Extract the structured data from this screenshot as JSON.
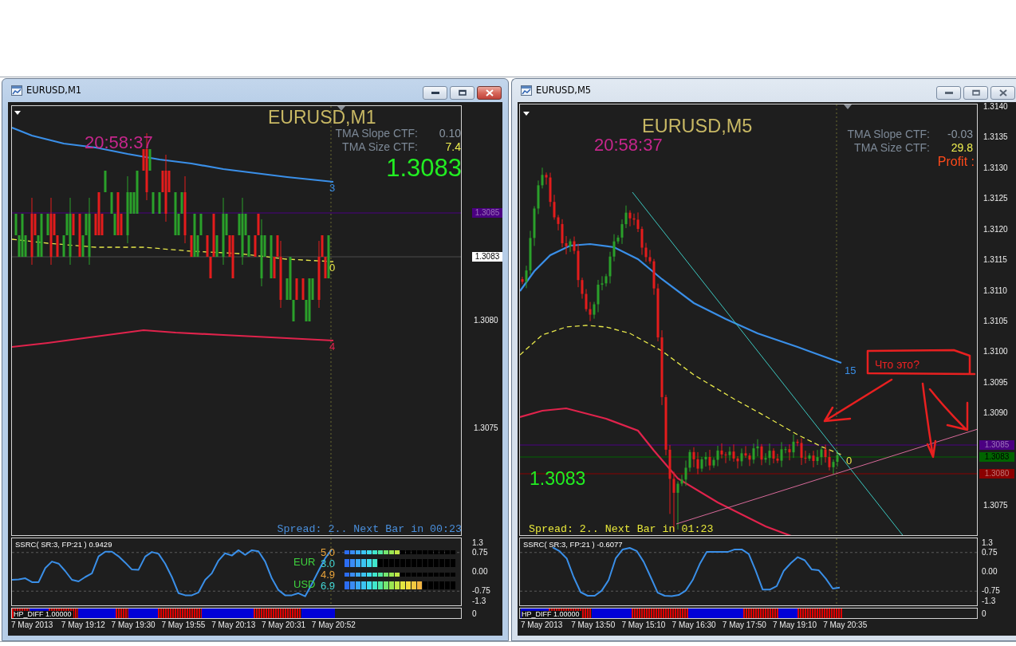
{
  "windows": [
    {
      "title": "EURUSD,M1",
      "active": true,
      "chart": {
        "symbol": "EURUSD,M1",
        "clock": "20:58:37",
        "indicators": [
          {
            "label": "TMA Slope CTF:",
            "value": "0.10",
            "color": "#8a96a3"
          },
          {
            "label": "TMA Size CTF:",
            "value": "7.4",
            "color": "#f0f050"
          }
        ],
        "price": "1.3083",
        "band_labels": [
          {
            "kind": "upper",
            "text": "3"
          },
          {
            "kind": "middle",
            "text": "0"
          },
          {
            "kind": "lower",
            "text": "4"
          }
        ],
        "spread": {
          "text": "Spread: 2.. Next Bar in 00:23",
          "color": "#4a8fdc"
        },
        "price_axis": [
          "1.3080",
          "1.3075"
        ],
        "price_tags": [
          {
            "text": "1.3085",
            "color": "#4b0082"
          },
          {
            "text": "1.3083",
            "color": "#ffffff"
          }
        ]
      },
      "oscillator": {
        "chart_data": {
          "type": "line",
          "title": "SSRC( SR:3, FP:21 ) 0.9429",
          "ylim": [
            -1.3,
            1.3
          ],
          "yticks": [
            {
              "value": 1.3,
              "label": "1.3"
            },
            {
              "value": 0.75,
              "label": "0.75"
            },
            {
              "value": 0,
              "label": "0.00"
            },
            {
              "value": -0.75,
              "label": "-0.75"
            },
            {
              "value": -1.3,
              "label": "-1.3"
            }
          ],
          "values": [
            -0.31,
            -0.29,
            -0.25,
            -0.4,
            -0.4,
            0.15,
            0.4,
            0.32,
            0.03,
            -0.31,
            -0.37,
            -0.2,
            -0.06,
            0.6,
            0.78,
            0.78,
            0.6,
            0.36,
            0.09,
            0.08,
            0.59,
            0.77,
            0.7,
            0.32,
            -0.2,
            -0.83,
            -0.91,
            -0.91,
            -0.8,
            -0.31,
            -0.06,
            0.44,
            0.72,
            0.63,
            0.84,
            0.66,
            0.84,
            0.8,
            0.4,
            -0.25,
            -0.71,
            -0.91,
            -0.91,
            -0.83,
            -0.95,
            -0.48,
            0.03,
            0.52,
            0.87
          ]
        },
        "strength": [
          {
            "currency": "EUR",
            "rows": [
              {
                "kind": "thin",
                "reading": "5.0",
                "level": 0.5
              },
              {
                "kind": "thick",
                "reading": "3.0",
                "level": 0.3
              }
            ]
          },
          {
            "currency": "USD",
            "rows": [
              {
                "kind": "thin",
                "reading": "4.9",
                "level": 0.49
              },
              {
                "kind": "thick",
                "reading": "6.9",
                "level": 0.69
              }
            ]
          }
        ]
      },
      "histogram": {
        "label": "HP_DIFF 1.00000",
        "axis_label": "0"
      },
      "time_axis": [
        "7 May 2013",
        "7 May 19:12",
        "7 May 19:30",
        "7 May 19:55",
        "7 May 20:13",
        "7 May 20:31",
        "7 May 20:52"
      ]
    },
    {
      "title": "EURUSD,M5",
      "active": false,
      "chart": {
        "symbol": "EURUSD,M5",
        "clock": "20:58:37",
        "indicators": [
          {
            "label": "TMA Slope CTF:",
            "value": "-0.03",
            "color": "#8a96a3"
          },
          {
            "label": "TMA Size CTF:",
            "value": "29.8",
            "color": "#f0f050"
          }
        ],
        "profit_label": "Profit :",
        "price": "1.3083",
        "band_labels": [
          {
            "kind": "upper",
            "text": "15"
          },
          {
            "kind": "middle",
            "text": "0"
          }
        ],
        "spread": {
          "text": "Spread: 2.. Next Bar in 01:23",
          "color": "#e8e83a"
        },
        "note": "Что это?",
        "price_axis": [
          "1.3140",
          "1.3135",
          "1.3130",
          "1.3125",
          "1.3120",
          "1.3115",
          "1.3110",
          "1.3105",
          "1.3100",
          "1.3095",
          "1.3090",
          "1.3075"
        ],
        "price_tags": [
          {
            "text": "1.3085",
            "color": "#4b0082"
          },
          {
            "text": "1.3083",
            "color": "#006400"
          },
          {
            "text": "1.3080",
            "color": "#8b0000"
          }
        ]
      },
      "oscillator": {
        "chart_data": {
          "type": "line",
          "title": "SSRC( SR:3, FP:21 ) -0.6077",
          "ylim": [
            -1.3,
            1.3
          ],
          "yticks": [
            {
              "value": 1.3,
              "label": "1.3"
            },
            {
              "value": 0.75,
              "label": "0.75"
            },
            {
              "value": 0,
              "label": "0.00"
            },
            {
              "value": -0.75,
              "label": "-0.75"
            },
            {
              "value": -1.3,
              "label": "-1.3"
            }
          ],
          "values": [
            0.95,
            0.8,
            0.52,
            -0.2,
            -0.79,
            -0.93,
            -0.93,
            -0.73,
            -0.32,
            0.52,
            0.87,
            0.93,
            0.81,
            0.39,
            -0.2,
            -0.81,
            -0.93,
            -0.94,
            -0.9,
            -0.73,
            -0.32,
            0.3,
            0.77,
            0.77,
            0.77,
            0.77,
            0.87,
            0.87,
            0.69,
            0.04,
            -0.69,
            -0.69,
            -0.55,
            0.04,
            0.33,
            0.57,
            0.45,
            0.09,
            0.06,
            -0.26,
            -0.65,
            -0.61
          ]
        }
      },
      "histogram": {
        "label": "HP_DIFF 1.00000",
        "axis_label": "0"
      },
      "time_axis": [
        "7 May 2013",
        "7 May 13:50",
        "7 May 15:10",
        "7 May 16:30",
        "7 May 17:50",
        "7 May 19:10",
        "7 May 20:35"
      ]
    }
  ]
}
